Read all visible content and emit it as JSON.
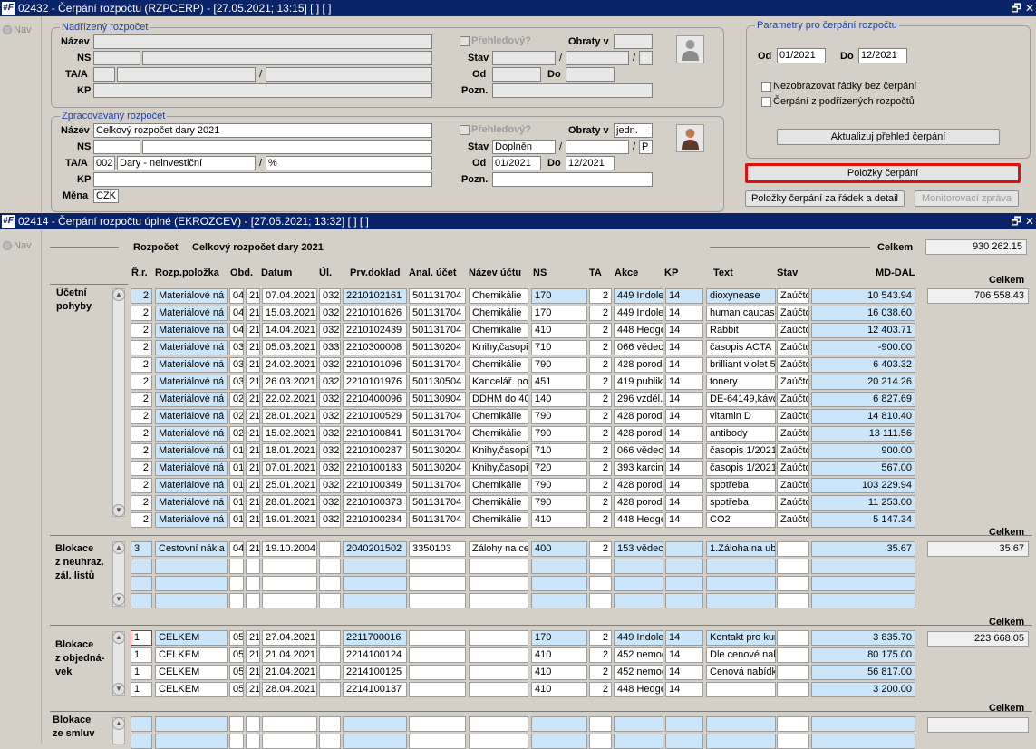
{
  "win1": {
    "logo": "#F",
    "title": "02432 - Čerpání rozpočtu (RZPCERP) - [27.05.2021; 13:15] [ ] [ ]",
    "restore": "🗗",
    "close": "✕"
  },
  "win2": {
    "logo": "#F",
    "title": "02414 - Čerpání rozpočtu úplné (EKROZCEV) - [27.05.2021; 13:32] [ ] [ ]",
    "restore": "🗗",
    "close": "✕"
  },
  "nav": "Nav",
  "parent": {
    "title": "Nadřízený rozpočet",
    "labels": {
      "nazev": "Název",
      "ns": "NS",
      "taa": "TA/A",
      "kp": "KP",
      "prehled": "Přehledový?",
      "obraty": "Obraty v",
      "stav": "Stav",
      "od": "Od",
      "do": "Do",
      "pozn": "Pozn."
    },
    "values": {
      "nazev": "",
      "ns1": "",
      "ns2": "",
      "ta": "",
      "a": "",
      "a2": "",
      "kp": "",
      "obraty": "",
      "stav": "",
      "stav2": "",
      "stav3": "",
      "od": "",
      "do": "",
      "pozn": ""
    }
  },
  "proc": {
    "title": "Zpracovávaný rozpočet",
    "labels": {
      "nazev": "Název",
      "ns": "NS",
      "taa": "TA/A",
      "kp": "KP",
      "mena": "Měna",
      "prehled": "Přehledový?",
      "obraty": "Obraty v",
      "stav": "Stav",
      "od": "Od",
      "do": "Do",
      "pozn": "Pozn."
    },
    "values": {
      "nazev": "Celkový rozpočet dary 2021",
      "ns1": "",
      "ns2": "",
      "ta": "002",
      "a": "Dary - neinvestiční",
      "a2": "%",
      "kp": "",
      "mena": "CZK",
      "obraty": "jedn.",
      "stav": "Doplněn",
      "stav2": "",
      "stav3": "P",
      "od": "01/2021",
      "do": "12/2021",
      "pozn": ""
    }
  },
  "params": {
    "title": "Parametry pro čerpání rozpočtu",
    "od_label": "Od",
    "od": "01/2021",
    "do_label": "Do",
    "do": "12/2021",
    "chk1": "Nezobrazovat řádky bez čerpání",
    "chk2": "Čerpání z podřízených rozpočtů",
    "refresh": "Aktualizuj přehled čerpání"
  },
  "buttons": {
    "polozky": "Položky čerpání",
    "polozky_detail": "Položky čerpání za řádek a detail",
    "monitor": "Monitorovací zpráva"
  },
  "header": {
    "rozpocet_label": "Rozpočet",
    "rozpocet": "Celkový rozpočet dary 2021",
    "celkem_label": "Celkem",
    "celkem": "930 262.15"
  },
  "columns": {
    "rr": "Ř.r.",
    "rozp": "Rozp.položka",
    "obd": "Obd.",
    "datum": "Datum",
    "ul": "Úl.",
    "prv": "Prv.doklad",
    "anal": "Anal. účet",
    "nazev": "Název účtu",
    "ns": "NS",
    "ta": "TA",
    "akce": "Akce",
    "kp": "KP",
    "text": "Text",
    "stav": "Stav",
    "md": "MD-DAL"
  },
  "sections": {
    "ucetni": {
      "label1": "Účetní",
      "label2": "pohyby",
      "celkem_label": "Celkem",
      "celkem": "706 558.43",
      "rows": [
        [
          "2",
          "Materiálové ná",
          "04",
          "21",
          "07.04.2021",
          "032",
          "2210102161",
          "501131704",
          "Chemikálie",
          "170",
          "2",
          "449 Indolea",
          "14",
          "dioxynease",
          "Zaúčto",
          "10 543.94"
        ],
        [
          "2",
          "Materiálové ná",
          "04",
          "21",
          "15.03.2021",
          "032",
          "2210101626",
          "501131704",
          "Chemikálie",
          "170",
          "2",
          "449 Indolea",
          "14",
          "human caucasi",
          "Zaúčto",
          "16 038.60"
        ],
        [
          "2",
          "Materiálové ná",
          "04",
          "21",
          "14.04.2021",
          "032",
          "2210102439",
          "501131704",
          "Chemikálie",
          "410",
          "2",
          "448 Hedge",
          "14",
          "Rabbit",
          "Zaúčto",
          "12 403.71"
        ],
        [
          "2",
          "Materiálové ná",
          "03",
          "21",
          "05.03.2021",
          "033",
          "2210300008",
          "501130204",
          "Knihy,časopis",
          "710",
          "2",
          "066 vědec",
          "14",
          "časopis ACTA",
          "Zaúčto",
          "-900.00"
        ],
        [
          "2",
          "Materiálové ná",
          "03",
          "21",
          "24.02.2021",
          "032",
          "2210101096",
          "501131704",
          "Chemikálie",
          "790",
          "2",
          "428 porodr",
          "14",
          "brilliant violet 5",
          "Zaúčto",
          "6 403.32"
        ],
        [
          "2",
          "Materiálové ná",
          "03",
          "21",
          "26.03.2021",
          "032",
          "2210101976",
          "501130504",
          "Kancelář. pot",
          "451",
          "2",
          "419 publika",
          "14",
          "tonery",
          "Zaúčto",
          "20 214.26"
        ],
        [
          "2",
          "Materiálové ná",
          "02",
          "21",
          "22.02.2021",
          "032",
          "2210400096",
          "501130904",
          "DDHM do 400",
          "140",
          "2",
          "296 vzděl.,",
          "14",
          "DE-64149,kávo",
          "Zaúčto",
          "6 827.69"
        ],
        [
          "2",
          "Materiálové ná",
          "02",
          "21",
          "28.01.2021",
          "032",
          "2210100529",
          "501131704",
          "Chemikálie",
          "790",
          "2",
          "428 porodr",
          "14",
          "vitamin D",
          "Zaúčto",
          "14 810.40"
        ],
        [
          "2",
          "Materiálové ná",
          "02",
          "21",
          "15.02.2021",
          "032",
          "2210100841",
          "501131704",
          "Chemikálie",
          "790",
          "2",
          "428 porodr",
          "14",
          "antibody",
          "Zaúčto",
          "13 111.56"
        ],
        [
          "2",
          "Materiálové ná",
          "01",
          "21",
          "18.01.2021",
          "032",
          "2210100287",
          "501130204",
          "Knihy,časopis",
          "710",
          "2",
          "066 vědec",
          "14",
          "časopis 1/2021",
          "Zaúčto",
          "900.00"
        ],
        [
          "2",
          "Materiálové ná",
          "01",
          "21",
          "07.01.2021",
          "032",
          "2210100183",
          "501130204",
          "Knihy,časopis",
          "720",
          "2",
          "393 karcin",
          "14",
          "časopis 1/2021",
          "Zaúčto",
          "567.00"
        ],
        [
          "2",
          "Materiálové ná",
          "01",
          "21",
          "25.01.2021",
          "032",
          "2210100349",
          "501131704",
          "Chemikálie",
          "790",
          "2",
          "428 porodr",
          "14",
          "spotřeba",
          "Zaúčto",
          "103 229.94"
        ],
        [
          "2",
          "Materiálové ná",
          "01",
          "21",
          "28.01.2021",
          "032",
          "2210100373",
          "501131704",
          "Chemikálie",
          "790",
          "2",
          "428 porodr",
          "14",
          "spotřeba",
          "Zaúčto",
          "11 253.00"
        ],
        [
          "2",
          "Materiálové ná",
          "01",
          "21",
          "19.01.2021",
          "032",
          "2210100284",
          "501131704",
          "Chemikálie",
          "410",
          "2",
          "448 Hedge",
          "14",
          "CO2",
          "Zaúčto",
          "5 147.34"
        ]
      ]
    },
    "neuhraz": {
      "label1": "Blokace",
      "label2": "z neuhraz.",
      "label3": "zál. listů",
      "celkem_label": "Celkem",
      "celkem": "35.67",
      "rows": [
        [
          "3",
          "Cestovní nákla",
          "04",
          "21",
          "19.10.2004",
          "",
          "2040201502",
          "3350103",
          "Zálohy na ce",
          "400",
          "2",
          "153 vědec",
          "",
          "1.Záloha na ub",
          "",
          "35.67"
        ]
      ]
    },
    "objed": {
      "label1": "Blokace",
      "label2": "z objedná-",
      "label3": "vek",
      "celkem_label": "Celkem",
      "celkem": "223 668.05",
      "rows": [
        [
          "1",
          "CELKEM",
          "05",
          "21",
          "27.04.2021",
          "",
          "2211700016",
          "",
          "",
          "170",
          "2",
          "449 Indolea",
          "14",
          "Kontakt pro kur",
          "",
          "3 835.70"
        ],
        [
          "1",
          "CELKEM",
          "05",
          "21",
          "21.04.2021",
          "",
          "2214100124",
          "",
          "",
          "410",
          "2",
          "452 nemoc",
          "14",
          "Dle cenové nab",
          "",
          "80 175.00"
        ],
        [
          "1",
          "CELKEM",
          "05",
          "21",
          "21.04.2021",
          "",
          "2214100125",
          "",
          "",
          "410",
          "2",
          "452 nemoc",
          "14",
          "Cenová nabídka",
          "",
          "56 817.00"
        ],
        [
          "1",
          "CELKEM",
          "05",
          "21",
          "28.04.2021",
          "",
          "2214100137",
          "",
          "",
          "410",
          "2",
          "448 Hedge",
          "14",
          "",
          "",
          "3 200.00"
        ]
      ]
    },
    "smluv": {
      "label1": "Blokace",
      "label2": "ze smluv",
      "celkem_label": "Celkem",
      "celkem": ""
    }
  }
}
